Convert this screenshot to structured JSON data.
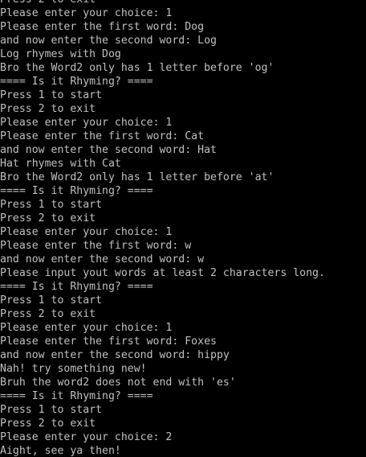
{
  "console": {
    "background": "#000000",
    "foreground": "#c0c0c0",
    "lines": [
      "Press 2 to exit",
      "Please enter your choice: 1",
      "Please enter the first word: Dog",
      "and now enter the second word: Log",
      "Log rhymes with Dog",
      "Bro the Word2 only has 1 letter before 'og'",
      "==== Is it Rhyming? ====",
      "Press 1 to start",
      "Press 2 to exit",
      "Please enter your choice: 1",
      "Please enter the first word: Cat",
      "and now enter the second word: Hat",
      "Hat rhymes with Cat",
      "Bro the Word2 only has 1 letter before 'at'",
      "==== Is it Rhyming? ====",
      "Press 1 to start",
      "Press 2 to exit",
      "Please enter your choice: 1",
      "Please enter the first word: w",
      "and now enter the second word: w",
      "Please input yout words at least 2 characters long.",
      "==== Is it Rhyming? ====",
      "Press 1 to start",
      "Press 2 to exit",
      "Please enter your choice: 1",
      "Please enter the first word: Foxes",
      "and now enter the second word: hippy",
      "Nah! try something new!",
      "Bruh the word2 does not end with 'es'",
      "==== Is it Rhyming? ====",
      "Press 1 to start",
      "Press 2 to exit",
      "Please enter your choice: 2",
      "Aight, see ya then!"
    ]
  }
}
